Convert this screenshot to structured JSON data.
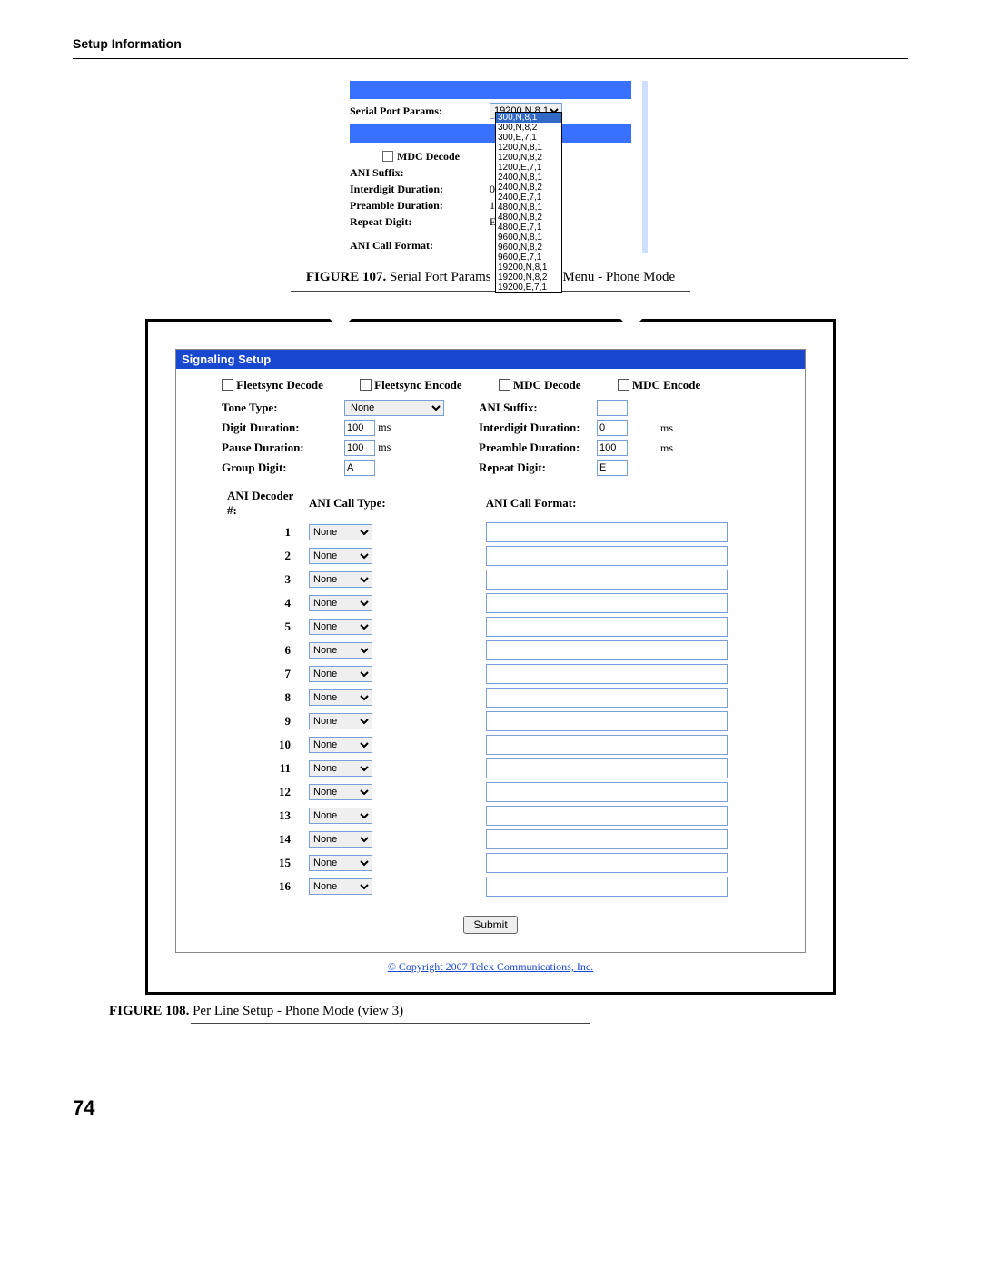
{
  "header": {
    "title": "Setup Information"
  },
  "figure107": {
    "serial_port_params_label": "Serial Port Params:",
    "serial_port_params_value": "19200,N,8,1",
    "mdc_decode_label": "MDC Decode",
    "ani_suffix_label": "ANI Suffix:",
    "interdigit_label": "Interdigit Duration:",
    "interdigit_value": "0",
    "preamble_label": "Preamble Duration:",
    "preamble_value": "1",
    "repeat_label": "Repeat Digit:",
    "repeat_value": "E",
    "ani_call_format_label": "ANI Call Format:",
    "dropdown_options": [
      "300,N,8,1",
      "300,N,8,2",
      "300,E,7,1",
      "1200,N,8,1",
      "1200,N,8,2",
      "1200,E,7,1",
      "2400,N,8,1",
      "2400,N,8,2",
      "2400,E,7,1",
      "4800,N,8,1",
      "4800,N,8,2",
      "4800,E,7,1",
      "9600,N,8,1",
      "9600,N,8,2",
      "9600,E,7,1",
      "19200,N,8,1",
      "19200,N,8,2",
      "19200,E,7,1"
    ],
    "caption_prefix": "FIGURE 107.",
    "caption": "Serial Port Params Drop Down Menu - Phone Mode"
  },
  "figure108": {
    "panel_title": "Signaling Setup",
    "fleetsync_decode_label": "Fleetsync Decode",
    "fleetsync_encode_label": "Fleetsync Encode",
    "mdc_decode_label": "MDC Decode",
    "mdc_encode_label": "MDC Encode",
    "tone_type_label": "Tone Type:",
    "tone_type_value": "None",
    "digit_duration_label": "Digit Duration:",
    "digit_duration_value": "100",
    "pause_duration_label": "Pause Duration:",
    "pause_duration_value": "100",
    "group_digit_label": "Group Digit:",
    "group_digit_value": "A",
    "ani_suffix_label": "ANI Suffix:",
    "ani_suffix_value": "",
    "interdigit_label": "Interdigit Duration:",
    "interdigit_value": "0",
    "preamble_label": "Preamble Duration:",
    "preamble_value": "100",
    "repeat_digit_label": "Repeat Digit:",
    "repeat_digit_value": "E",
    "unit_ms": "ms",
    "ani_decoder_header": "ANI Decoder #:",
    "ani_call_type_header": "ANI Call Type:",
    "ani_call_format_header": "ANI Call Format:",
    "decoders": [
      {
        "n": "1",
        "type": "None",
        "fmt": ""
      },
      {
        "n": "2",
        "type": "None",
        "fmt": ""
      },
      {
        "n": "3",
        "type": "None",
        "fmt": ""
      },
      {
        "n": "4",
        "type": "None",
        "fmt": ""
      },
      {
        "n": "5",
        "type": "None",
        "fmt": ""
      },
      {
        "n": "6",
        "type": "None",
        "fmt": ""
      },
      {
        "n": "7",
        "type": "None",
        "fmt": ""
      },
      {
        "n": "8",
        "type": "None",
        "fmt": ""
      },
      {
        "n": "9",
        "type": "None",
        "fmt": ""
      },
      {
        "n": "10",
        "type": "None",
        "fmt": ""
      },
      {
        "n": "11",
        "type": "None",
        "fmt": ""
      },
      {
        "n": "12",
        "type": "None",
        "fmt": ""
      },
      {
        "n": "13",
        "type": "None",
        "fmt": ""
      },
      {
        "n": "14",
        "type": "None",
        "fmt": ""
      },
      {
        "n": "15",
        "type": "None",
        "fmt": ""
      },
      {
        "n": "16",
        "type": "None",
        "fmt": ""
      }
    ],
    "submit_label": "Submit",
    "copyright": "© Copyright 2007 Telex Communications, Inc.",
    "caption_prefix": "FIGURE 108.",
    "caption": "Per Line Setup - Phone Mode (view 3)"
  },
  "page_number": "74"
}
